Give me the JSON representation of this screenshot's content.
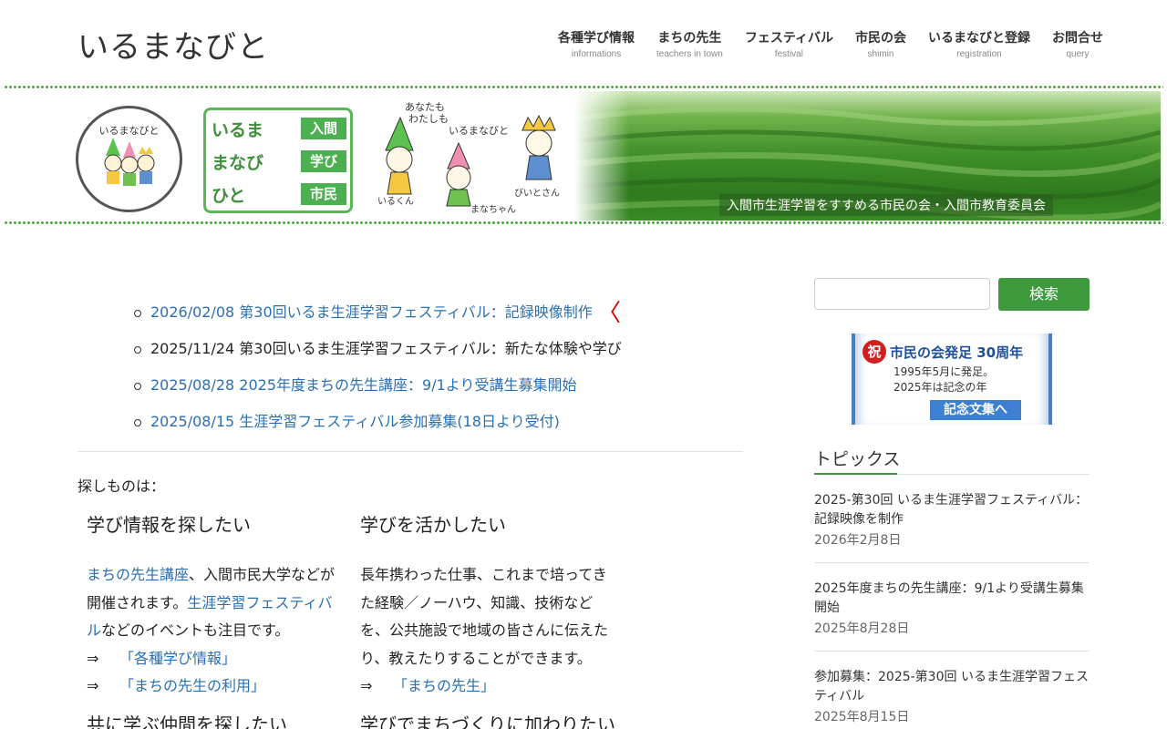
{
  "site": {
    "title": "いるまなびと"
  },
  "nav": [
    {
      "label": "各種学び情報",
      "sub": "informations"
    },
    {
      "label": "まちの先生",
      "sub": "teachers in town"
    },
    {
      "label": "フェスティバル",
      "sub": "festival"
    },
    {
      "label": "市民の会",
      "sub": "shimin"
    },
    {
      "label": "いるまなびと登録",
      "sub": "registration"
    },
    {
      "label": "お問合せ",
      "sub": "query"
    }
  ],
  "banner": {
    "logo_text": "いるまなびと",
    "kanji": [
      {
        "left": "いるま",
        "right": "入間"
      },
      {
        "left": "まなび",
        "right": "学び"
      },
      {
        "left": "ひと",
        "right": "市民"
      }
    ],
    "slogan": [
      "あなたも",
      "わたしも",
      "いるまなびと"
    ],
    "characters": [
      "いるくん",
      "まなちゃん",
      "びいとさん"
    ],
    "caption": "入間市生涯学習をすすめる市民の会・入間市教育委員会"
  },
  "news": [
    {
      "text": "2026/02/08 第30回いるま生涯学習フェスティバル：記録映像制作",
      "link": true
    },
    {
      "text": "2025/11/24 第30回いるま生涯学習フェスティバル：新たな体験や学び",
      "link": false
    },
    {
      "text": "2025/08/28 2025年度まちの先生講座：9/1より受講生募集開始",
      "link": true
    },
    {
      "text": "2025/08/15 生涯学習フェスティバル参加募集(18日より受付)",
      "link": true
    }
  ],
  "news_arrow": "〈",
  "search_prompt": "探しものは：",
  "sections": {
    "learn": {
      "heading": "学び情報を探したい",
      "link1": "まちの先生講座",
      "text1": "、入間市民大学などが開催されます。",
      "link2": "生涯学習フェスティバル",
      "text2": "などのイベントも注目です。",
      "arrow": "⇒",
      "sublink1": "「各種学び情報」",
      "sublink2": "「まちの先生の利用」"
    },
    "use": {
      "heading": "学びを活かしたい",
      "body": "長年携わった仕事、これまで培ってきた経験／ノーハウ、知識、技術などを、公共施設で地域の皆さんに伝えたり、教えたりすることができます。",
      "arrow": "⇒",
      "sublink1": "「まちの先生」"
    },
    "peers": {
      "heading": "共に学ぶ仲間を探したい"
    },
    "town": {
      "heading": "学びでまちづくりに加わりたい"
    }
  },
  "sidebar": {
    "search_button": "検索",
    "anniversary": {
      "badge": "祝",
      "title": "市民の会発足 30周年",
      "line1": "1995年5月に発足。",
      "line2": "2025年は記念の年",
      "button": "記念文集へ"
    },
    "topics_heading": "トピックス",
    "topics": [
      {
        "title": "2025-第30回 いるま生涯学習フェスティバル：記録映像を制作",
        "date": "2026年2月8日"
      },
      {
        "title": "2025年度まちの先生講座：9/1より受講生募集開始",
        "date": "2025年8月28日"
      },
      {
        "title": "参加募集：2025-第30回 いるま生涯学習フェスティバル",
        "date": "2025年8月15日"
      }
    ]
  },
  "colors": {
    "accent_green": "#3c9a3c",
    "link_blue": "#2a6fb3",
    "alert_red": "#d40000"
  }
}
